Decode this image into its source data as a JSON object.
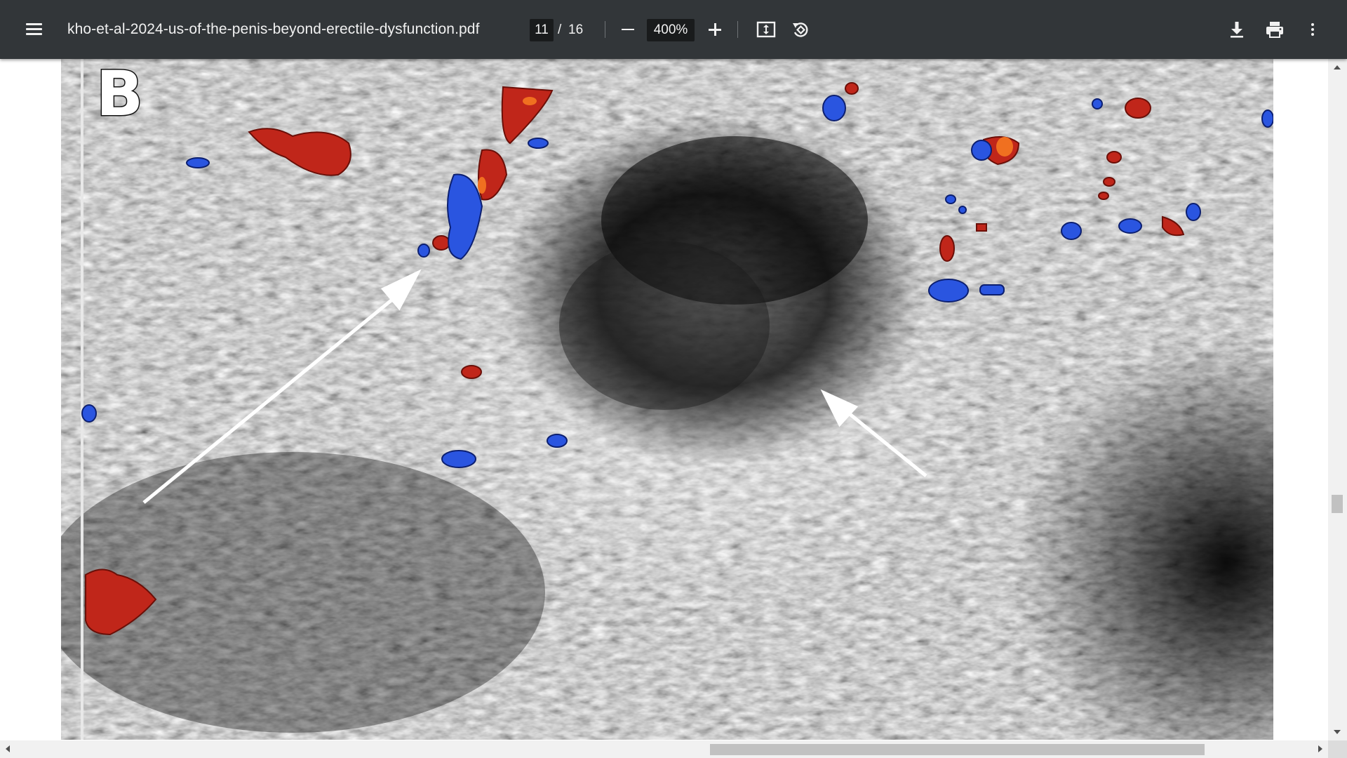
{
  "toolbar": {
    "menu_icon": "hamburger-menu-icon",
    "title": "kho-et-al-2024-us-of-the-penis-beyond-erectile-dysfunction.pdf",
    "page_current": "11",
    "page_separator": "/",
    "page_total": "16",
    "zoom_value": "400%",
    "icons": {
      "zoom_out": "minus-icon",
      "zoom_in": "plus-icon",
      "fit": "fit-to-page-icon",
      "rotate": "rotate-counterclockwise-icon",
      "download": "download-icon",
      "print": "print-icon",
      "more": "more-vertical-icon"
    },
    "colors": {
      "background": "#323639",
      "input_background": "#191b1c",
      "text": "#f1f1f1"
    }
  },
  "document": {
    "figure_label": "B",
    "image_description_colors": {
      "doppler_red": "#c0261a",
      "doppler_blue": "#2a55e0"
    }
  }
}
